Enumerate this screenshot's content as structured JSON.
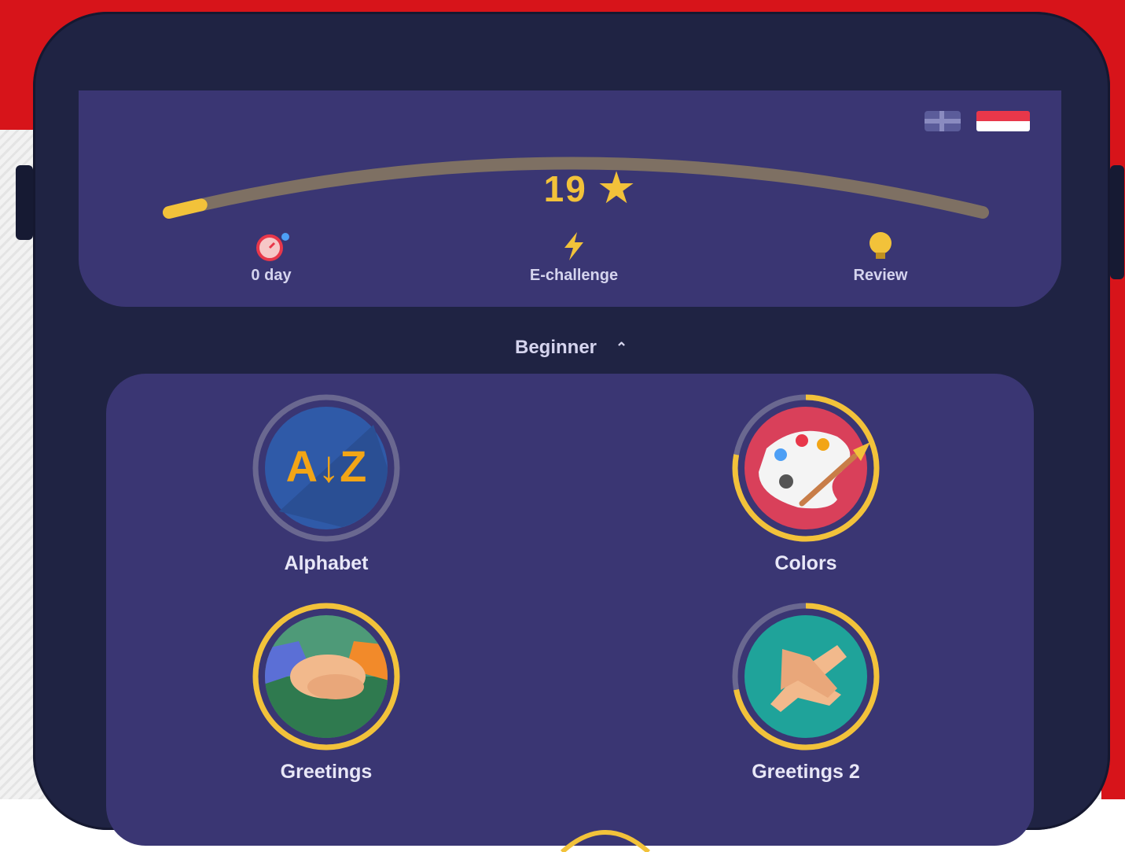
{
  "app": {
    "languages": [
      "uk-flag-icon",
      "indonesia-flag-icon"
    ],
    "stars": "19",
    "progress": 0.04,
    "stats": [
      {
        "label": "0 day",
        "icon": "streak-clock-icon"
      },
      {
        "label": "E-challenge",
        "icon": "lightning-icon"
      },
      {
        "label": "Review",
        "icon": "lightbulb-icon"
      }
    ],
    "filter": {
      "label": "Beginner",
      "icon": "chevron-up-icon"
    },
    "topics": [
      {
        "label": "Alphabet",
        "icon": "alphabet-az-icon",
        "progress": 0.0
      },
      {
        "label": "Colors",
        "icon": "palette-icon",
        "progress": 0.78
      },
      {
        "label": "Greetings",
        "icon": "handshake-icon",
        "progress": 1.0
      },
      {
        "label": "Greetings 2",
        "icon": "clapping-hands-icon",
        "progress": 0.72
      }
    ]
  },
  "colors": {
    "accent": "#f2c23a",
    "card": "#3a3673",
    "frame": "#1f2343",
    "brand_red": "#d7141a"
  }
}
